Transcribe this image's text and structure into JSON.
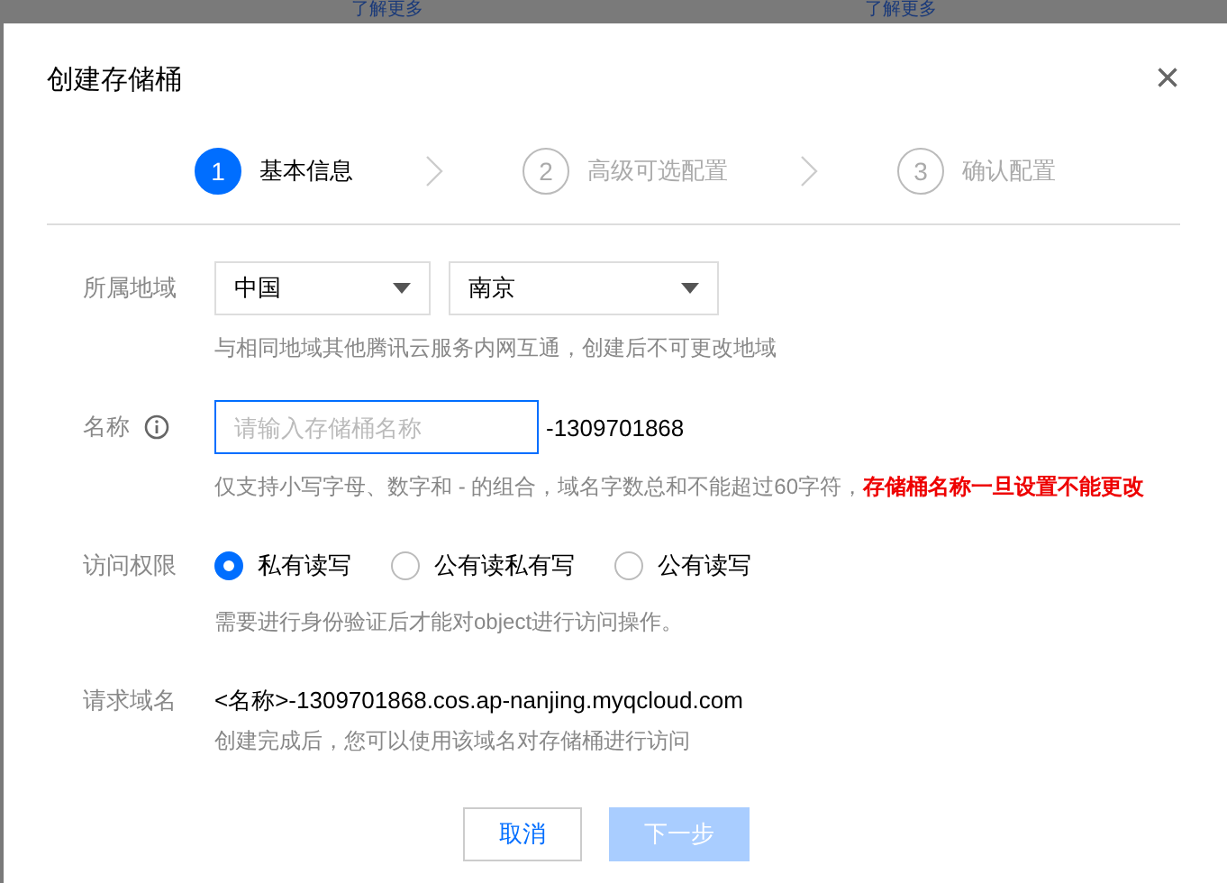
{
  "backdrop": {
    "links": [
      "了解更多",
      "了解更多"
    ]
  },
  "dialog": {
    "title": "创建存储桶",
    "close": "×"
  },
  "steps": [
    {
      "number": "1",
      "label": "基本信息",
      "selected": true
    },
    {
      "number": "2",
      "label": "高级可选配置",
      "selected": false
    },
    {
      "number": "3",
      "label": "确认配置",
      "selected": false
    }
  ],
  "region": {
    "label": "所属地域",
    "selects": [
      {
        "value": "中国"
      },
      {
        "value": "南京"
      }
    ],
    "hint": "与相同地域其他腾讯云服务内网互通，创建后不可更改地域"
  },
  "name": {
    "label": "名称",
    "placeholder": "请输入存储桶名称",
    "suffix": "-1309701868",
    "hint": "仅支持小写字母、数字和 - 的组合，域名字数总和不能超过60字符，",
    "warning": "存储桶名称一旦设置不能更改"
  },
  "access": {
    "label": "访问权限",
    "options": [
      {
        "label": "私有读写",
        "selected": true
      },
      {
        "label": "公有读私有写",
        "selected": false
      },
      {
        "label": "公有读写",
        "selected": false
      }
    ],
    "hint": "需要进行身份验证后才能对object进行访问操作。"
  },
  "domain": {
    "label": "请求域名",
    "value": "<名称>-1309701868.cos.ap-nanjing.myqcloud.com",
    "hint": "创建完成后，您可以使用该域名对存储桶进行访问"
  },
  "buttons": [
    {
      "label": "取消",
      "kind": "secondary",
      "disabled": false
    },
    {
      "label": "下一步",
      "kind": "primary",
      "disabled": true
    }
  ]
}
